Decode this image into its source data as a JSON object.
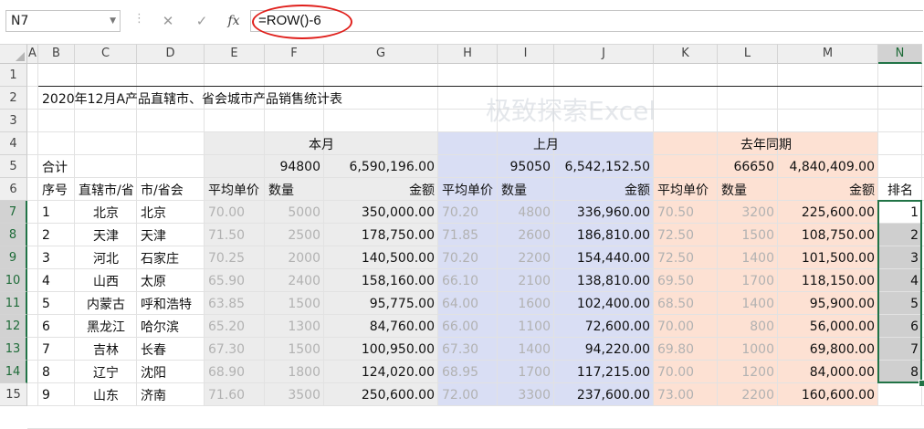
{
  "formula_bar": {
    "name_box": "N7",
    "cancel_icon": "✕",
    "enter_icon": "✓",
    "fx_label": "fx",
    "formula": "=ROW()-6"
  },
  "columns": [
    "A",
    "B",
    "C",
    "D",
    "E",
    "F",
    "G",
    "H",
    "I",
    "J",
    "K",
    "L",
    "M",
    "N"
  ],
  "selected_column": "N",
  "rows": [
    "1",
    "2",
    "3",
    "4",
    "5",
    "6",
    "7",
    "8",
    "9",
    "10",
    "11",
    "12",
    "13",
    "14",
    "15"
  ],
  "selected_rows": [
    "7",
    "8",
    "9",
    "10",
    "11",
    "12",
    "13",
    "14"
  ],
  "title": "2020年12月A产品直辖市、省会城市产品销售统计表",
  "watermark": "极致探索Excel",
  "colors": {
    "band_this_month": "#ececec",
    "band_last_month": "#d9def4",
    "band_last_year": "#fde1d3",
    "rank_fill": "#cfcfcf",
    "selection": "#217346",
    "circle": "#e0201c"
  },
  "groups": {
    "this_month": "本月",
    "last_month": "上月",
    "last_year": "去年同期"
  },
  "totals": {
    "label": "合计",
    "this_qty": "94800",
    "this_amt": "6,590,196.00",
    "last_qty": "95050",
    "last_amt": "6,542,152.50",
    "ly_qty": "66650",
    "ly_amt": "4,840,409.00"
  },
  "headers": {
    "seq": "序号",
    "region": "直辖市/省",
    "city": "市/省会",
    "price": "平均单价",
    "qty": "数量",
    "amount": "金额",
    "rank": "排名"
  },
  "data_rows": [
    {
      "seq": "1",
      "region": "北京",
      "city": "北京",
      "p1": "70.00",
      "q1": "5000",
      "a1": "350,000.00",
      "p2": "70.20",
      "q2": "4800",
      "a2": "336,960.00",
      "p3": "70.50",
      "q3": "3200",
      "a3": "225,600.00",
      "rank": "1"
    },
    {
      "seq": "2",
      "region": "天津",
      "city": "天津",
      "p1": "71.50",
      "q1": "2500",
      "a1": "178,750.00",
      "p2": "71.85",
      "q2": "2600",
      "a2": "186,810.00",
      "p3": "72.50",
      "q3": "1500",
      "a3": "108,750.00",
      "rank": "2"
    },
    {
      "seq": "3",
      "region": "河北",
      "city": "石家庄",
      "p1": "70.25",
      "q1": "2000",
      "a1": "140,500.00",
      "p2": "70.20",
      "q2": "2200",
      "a2": "154,440.00",
      "p3": "72.50",
      "q3": "1400",
      "a3": "101,500.00",
      "rank": "3"
    },
    {
      "seq": "4",
      "region": "山西",
      "city": "太原",
      "p1": "65.90",
      "q1": "2400",
      "a1": "158,160.00",
      "p2": "66.10",
      "q2": "2100",
      "a2": "138,810.00",
      "p3": "69.50",
      "q3": "1700",
      "a3": "118,150.00",
      "rank": "4"
    },
    {
      "seq": "5",
      "region": "内蒙古",
      "city": "呼和浩特",
      "p1": "63.85",
      "q1": "1500",
      "a1": "95,775.00",
      "p2": "64.00",
      "q2": "1600",
      "a2": "102,400.00",
      "p3": "68.50",
      "q3": "1400",
      "a3": "95,900.00",
      "rank": "5"
    },
    {
      "seq": "6",
      "region": "黑龙江",
      "city": "哈尔滨",
      "p1": "65.20",
      "q1": "1300",
      "a1": "84,760.00",
      "p2": "66.00",
      "q2": "1100",
      "a2": "72,600.00",
      "p3": "70.00",
      "q3": "800",
      "a3": "56,000.00",
      "rank": "6"
    },
    {
      "seq": "7",
      "region": "吉林",
      "city": "长春",
      "p1": "67.30",
      "q1": "1500",
      "a1": "100,950.00",
      "p2": "67.30",
      "q2": "1400",
      "a2": "94,220.00",
      "p3": "69.80",
      "q3": "1000",
      "a3": "69,800.00",
      "rank": "7"
    },
    {
      "seq": "8",
      "region": "辽宁",
      "city": "沈阳",
      "p1": "68.90",
      "q1": "1800",
      "a1": "124,020.00",
      "p2": "68.95",
      "q2": "1700",
      "a2": "117,215.00",
      "p3": "70.00",
      "q3": "1200",
      "a3": "84,000.00",
      "rank": "8"
    },
    {
      "seq": "9",
      "region": "山东",
      "city": "济南",
      "p1": "71.60",
      "q1": "3500",
      "a1": "250,600.00",
      "p2": "72.00",
      "q2": "3300",
      "a2": "237,600.00",
      "p3": "73.00",
      "q3": "2200",
      "a3": "160,600.00",
      "rank": ""
    }
  ]
}
